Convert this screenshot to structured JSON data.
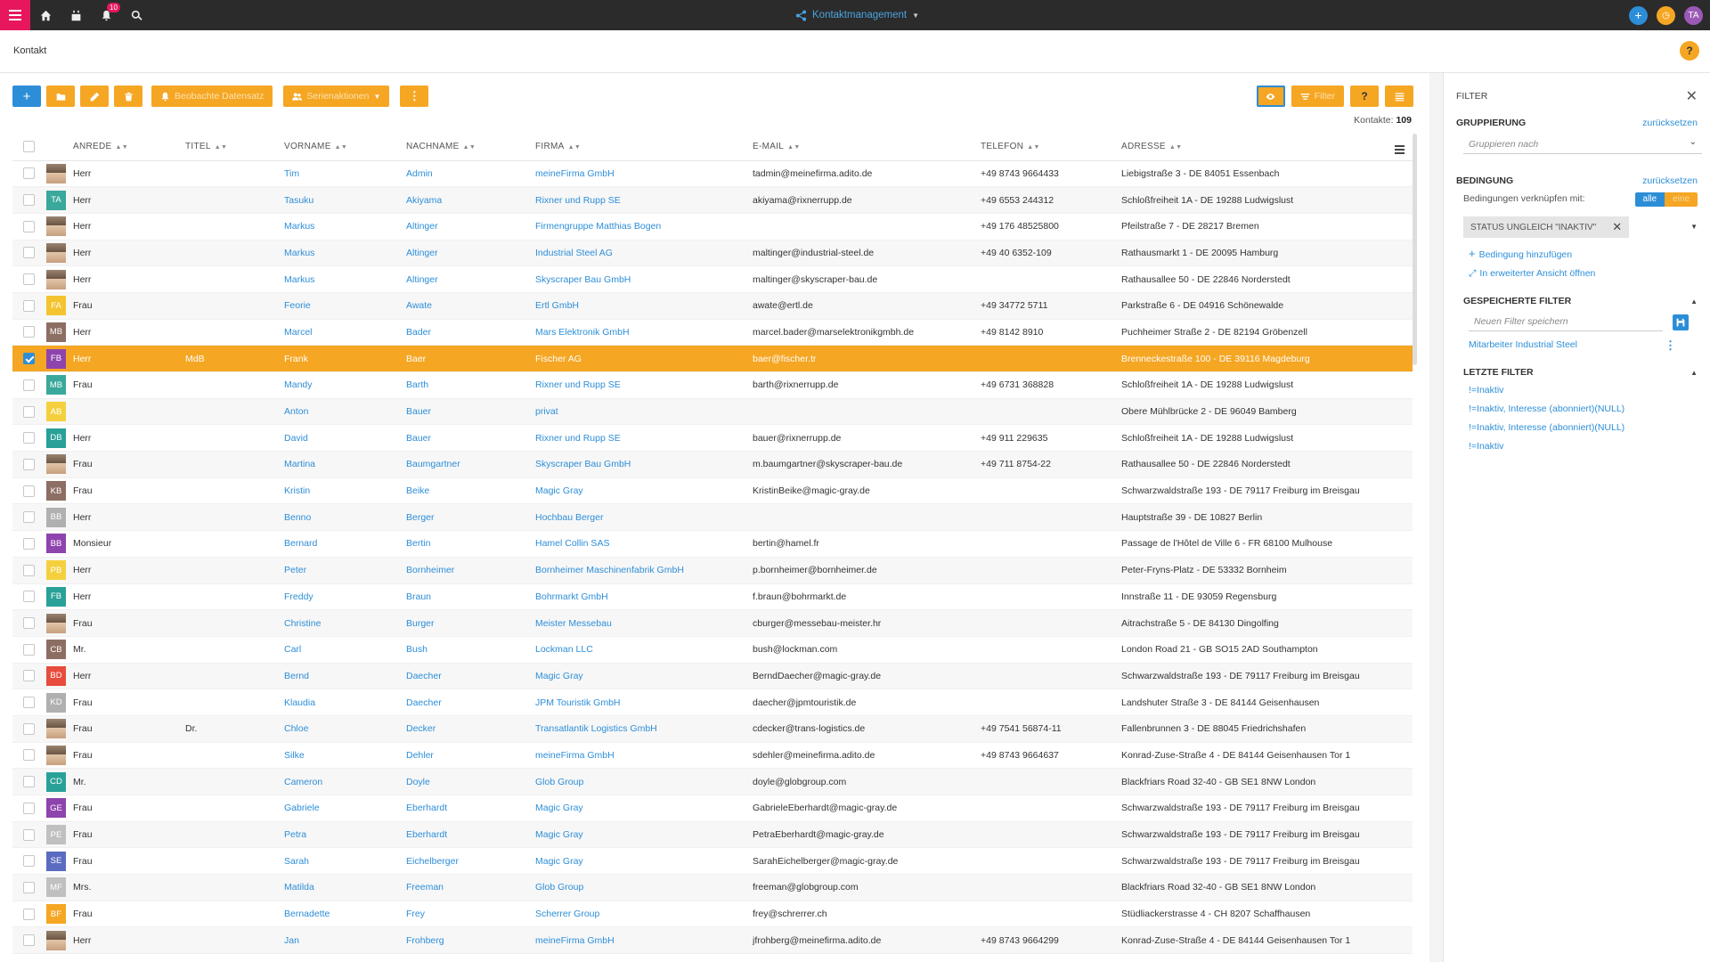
{
  "topbar": {
    "notifications": "10",
    "app_title": "Kontaktmanagement",
    "user_initials": "TA"
  },
  "breadcrumb": "Kontakt",
  "toolbar": {
    "observe_label": "Beobachte Datensatz",
    "series_label": "Serienaktionen",
    "filter_label": "Filter"
  },
  "count_label": "Kontakte:",
  "count_value": "109",
  "columns": [
    "Anrede",
    "Titel",
    "Vorname",
    "Nachname",
    "Firma",
    "E-Mail",
    "Telefon",
    "Adresse"
  ],
  "rows": [
    {
      "initials": "",
      "color": "",
      "photo": true,
      "anrede": "Herr",
      "titel": "",
      "vorname": "Tim",
      "nachname": "Admin",
      "firma": "meineFirma GmbH",
      "email": "tadmin@meinefirma.adito.de",
      "telefon": "+49 8743 9664433",
      "adresse": "Liebigstraße 3 - DE 84051 Essenbach"
    },
    {
      "initials": "TA",
      "color": "#3aa89b",
      "photo": false,
      "anrede": "Herr",
      "titel": "",
      "vorname": "Tasuku",
      "nachname": "Akiyama",
      "firma": "Rixner und Rupp SE",
      "email": "akiyama@rixnerrupp.de",
      "telefon": "+49 6553 244312",
      "adresse": "Schloßfreiheit 1A - DE 19288 Ludwigslust"
    },
    {
      "initials": "",
      "color": "",
      "photo": true,
      "anrede": "Herr",
      "titel": "",
      "vorname": "Markus",
      "nachname": "Altinger",
      "firma": "Firmengruppe Matthias Bogen",
      "email": "",
      "telefon": "+49 176 48525800",
      "adresse": "Pfeilstraße 7 - DE 28217 Bremen"
    },
    {
      "initials": "",
      "color": "",
      "photo": true,
      "anrede": "Herr",
      "titel": "",
      "vorname": "Markus",
      "nachname": "Altinger",
      "firma": "Industrial Steel AG",
      "email": "maltinger@industrial-steel.de",
      "telefon": "+49 40 6352-109",
      "adresse": "Rathausmarkt 1 - DE 20095 Hamburg"
    },
    {
      "initials": "",
      "color": "",
      "photo": true,
      "anrede": "Herr",
      "titel": "",
      "vorname": "Markus",
      "nachname": "Altinger",
      "firma": "Skyscraper Bau GmbH",
      "email": "maltinger@skyscraper-bau.de",
      "telefon": "",
      "adresse": "Rathausallee 50 - DE 22846 Norderstedt"
    },
    {
      "initials": "FA",
      "color": "#f4c430",
      "photo": false,
      "anrede": "Frau",
      "titel": "",
      "vorname": "Feorie",
      "nachname": "Awate",
      "firma": "Ertl GmbH",
      "email": "awate@ertl.de",
      "telefon": "+49 34772 5711",
      "adresse": "Parkstraße 6 - DE 04916 Schönewalde"
    },
    {
      "initials": "MB",
      "color": "#8d6e63",
      "photo": false,
      "anrede": "Herr",
      "titel": "",
      "vorname": "Marcel",
      "nachname": "Bader",
      "firma": "Mars Elektronik GmbH",
      "email": "marcel.bader@marselektronikgmbh.de",
      "telefon": "+49 8142 8910",
      "adresse": "Puchheimer Straße 2 - DE 82194 Gröbenzell"
    },
    {
      "initials": "FB",
      "color": "#8e44ad",
      "photo": false,
      "selected": true,
      "anrede": "Herr",
      "titel": "MdB",
      "vorname": "Frank",
      "nachname": "Baer",
      "firma": "Fischer AG",
      "email": "baer@fischer.tr",
      "telefon": "",
      "adresse": "Brenneckestraße 100 - DE 39116 Magdeburg"
    },
    {
      "initials": "MB",
      "color": "#3aa89b",
      "photo": false,
      "anrede": "Frau",
      "titel": "",
      "vorname": "Mandy",
      "nachname": "Barth",
      "firma": "Rixner und Rupp SE",
      "email": "barth@rixnerrupp.de",
      "telefon": "+49 6731 368828",
      "adresse": "Schloßfreiheit 1A - DE 19288 Ludwigslust"
    },
    {
      "initials": "AB",
      "color": "#f4d03f",
      "photo": false,
      "anrede": "",
      "titel": "",
      "vorname": "Anton",
      "nachname": "Bauer",
      "firma": "privat",
      "email": "",
      "telefon": "",
      "adresse": "Obere Mühlbrücke 2 - DE 96049 Bamberg"
    },
    {
      "initials": "DB",
      "color": "#2aa198",
      "photo": false,
      "anrede": "Herr",
      "titel": "",
      "vorname": "David",
      "nachname": "Bauer",
      "firma": "Rixner und Rupp SE",
      "email": "bauer@rixnerrupp.de",
      "telefon": "+49 911 229635",
      "adresse": "Schloßfreiheit 1A - DE 19288 Ludwigslust"
    },
    {
      "initials": "",
      "color": "",
      "photo": true,
      "anrede": "Frau",
      "titel": "",
      "vorname": "Martina",
      "nachname": "Baumgartner",
      "firma": "Skyscraper Bau GmbH",
      "email": "m.baumgartner@skyscraper-bau.de",
      "telefon": "+49 711 8754-22",
      "adresse": "Rathausallee 50 - DE 22846 Norderstedt"
    },
    {
      "initials": "KB",
      "color": "#8d6e63",
      "photo": false,
      "anrede": "Frau",
      "titel": "",
      "vorname": "Kristin",
      "nachname": "Beike",
      "firma": "Magic Gray",
      "email": "KristinBeike@magic-gray.de",
      "telefon": "",
      "adresse": "Schwarzwaldstraße 193 - DE 79117 Freiburg im Breisgau"
    },
    {
      "initials": "BB",
      "color": "#b0b0b0",
      "photo": false,
      "anrede": "Herr",
      "titel": "",
      "vorname": "Benno",
      "nachname": "Berger",
      "firma": "Hochbau Berger",
      "email": "",
      "telefon": "",
      "adresse": "Hauptstraße 39 - DE 10827 Berlin"
    },
    {
      "initials": "BB",
      "color": "#8e44ad",
      "photo": false,
      "anrede": "Monsieur",
      "titel": "",
      "vorname": "Bernard",
      "nachname": "Bertin",
      "firma": "Hamel Collin SAS",
      "email": "bertin@hamel.fr",
      "telefon": "",
      "adresse": "Passage de l'Hôtel de Ville 6 - FR 68100 Mulhouse"
    },
    {
      "initials": "PB",
      "color": "#f4d03f",
      "photo": false,
      "anrede": "Herr",
      "titel": "",
      "vorname": "Peter",
      "nachname": "Bornheimer",
      "firma": "Bornheimer Maschinenfabrik GmbH",
      "email": "p.bornheimer@bornheimer.de",
      "telefon": "",
      "adresse": "Peter-Fryns-Platz - DE 53332 Bornheim"
    },
    {
      "initials": "FB",
      "color": "#2aa198",
      "photo": false,
      "anrede": "Herr",
      "titel": "",
      "vorname": "Freddy",
      "nachname": "Braun",
      "firma": "Bohrmarkt GmbH",
      "email": "f.braun@bohrmarkt.de",
      "telefon": "",
      "adresse": "Innstraße 11 - DE 93059 Regensburg"
    },
    {
      "initials": "",
      "color": "",
      "photo": true,
      "anrede": "Frau",
      "titel": "",
      "vorname": "Christine",
      "nachname": "Burger",
      "firma": "Meister Messebau",
      "email": "cburger@messebau-meister.hr",
      "telefon": "",
      "adresse": "Aitrachstraße 5 - DE 84130 Dingolfing"
    },
    {
      "initials": "CB",
      "color": "#8d6e63",
      "photo": false,
      "anrede": "Mr.",
      "titel": "",
      "vorname": "Carl",
      "nachname": "Bush",
      "firma": "Lockman LLC",
      "email": "bush@lockman.com",
      "telefon": "",
      "adresse": "London Road 21 - GB SO15 2AD Southampton"
    },
    {
      "initials": "BD",
      "color": "#e74c3c",
      "photo": false,
      "anrede": "Herr",
      "titel": "",
      "vorname": "Bernd",
      "nachname": "Daecher",
      "firma": "Magic Gray",
      "email": "BerndDaecher@magic-gray.de",
      "telefon": "",
      "adresse": "Schwarzwaldstraße 193 - DE 79117 Freiburg im Breisgau"
    },
    {
      "initials": "KD",
      "color": "#b0b0b0",
      "photo": false,
      "anrede": "Frau",
      "titel": "",
      "vorname": "Klaudia",
      "nachname": "Daecher",
      "firma": "JPM Touristik GmbH",
      "email": "daecher@jpmtouristik.de",
      "telefon": "",
      "adresse": "Landshuter Straße 3 - DE 84144 Geisenhausen"
    },
    {
      "initials": "",
      "color": "",
      "photo": true,
      "anrede": "Frau",
      "titel": "Dr.",
      "vorname": "Chloe",
      "nachname": "Decker",
      "firma": "Transatlantik Logistics GmbH",
      "email": "cdecker@trans-logistics.de",
      "telefon": "+49 7541 56874-11",
      "adresse": "Fallenbrunnen 3 - DE 88045 Friedrichshafen"
    },
    {
      "initials": "",
      "color": "",
      "photo": true,
      "anrede": "Frau",
      "titel": "",
      "vorname": "Silke",
      "nachname": "Dehler",
      "firma": "meineFirma GmbH",
      "email": "sdehler@meinefirma.adito.de",
      "telefon": "+49 8743 9664637",
      "adresse": "Konrad-Zuse-Straße 4 - DE 84144 Geisenhausen Tor 1"
    },
    {
      "initials": "CD",
      "color": "#2aa198",
      "photo": false,
      "anrede": "Mr.",
      "titel": "",
      "vorname": "Cameron",
      "nachname": "Doyle",
      "firma": "Glob Group",
      "email": "doyle@globgroup.com",
      "telefon": "",
      "adresse": "Blackfriars Road 32-40 - GB SE1 8NW London"
    },
    {
      "initials": "GE",
      "color": "#8e44ad",
      "photo": false,
      "anrede": "Frau",
      "titel": "",
      "vorname": "Gabriele",
      "nachname": "Eberhardt",
      "firma": "Magic Gray",
      "email": "GabrieleEberhardt@magic-gray.de",
      "telefon": "",
      "adresse": "Schwarzwaldstraße 193 - DE 79117 Freiburg im Breisgau"
    },
    {
      "initials": "PE",
      "color": "#c0c0c0",
      "photo": false,
      "anrede": "Frau",
      "titel": "",
      "vorname": "Petra",
      "nachname": "Eberhardt",
      "firma": "Magic Gray",
      "email": "PetraEberhardt@magic-gray.de",
      "telefon": "",
      "adresse": "Schwarzwaldstraße 193 - DE 79117 Freiburg im Breisgau"
    },
    {
      "initials": "SE",
      "color": "#5b6bc0",
      "photo": false,
      "anrede": "Frau",
      "titel": "",
      "vorname": "Sarah",
      "nachname": "Eichelberger",
      "firma": "Magic Gray",
      "email": "SarahEichelberger@magic-gray.de",
      "telefon": "",
      "adresse": "Schwarzwaldstraße 193 - DE 79117 Freiburg im Breisgau"
    },
    {
      "initials": "MF",
      "color": "#c0c0c0",
      "photo": false,
      "anrede": "Mrs.",
      "titel": "",
      "vorname": "Matilda",
      "nachname": "Freeman",
      "firma": "Glob Group",
      "email": "freeman@globgroup.com",
      "telefon": "",
      "adresse": "Blackfriars Road 32-40 - GB SE1 8NW London"
    },
    {
      "initials": "BF",
      "color": "#f5a623",
      "photo": false,
      "anrede": "Frau",
      "titel": "",
      "vorname": "Bernadette",
      "nachname": "Frey",
      "firma": "Scherrer Group",
      "email": "frey@schrerrer.ch",
      "telefon": "",
      "adresse": "Stüdliackerstrasse 4 - CH 8207 Schaffhausen"
    },
    {
      "initials": "",
      "color": "",
      "photo": true,
      "anrede": "Herr",
      "titel": "",
      "vorname": "Jan",
      "nachname": "Frohberg",
      "firma": "meineFirma GmbH",
      "email": "jfrohberg@meinefirma.adito.de",
      "telefon": "+49 8743 9664299",
      "adresse": "Konrad-Zuse-Straße 4 - DE 84144 Geisenhausen Tor 1"
    }
  ],
  "filter": {
    "title": "FILTER",
    "grouping_title": "Gruppierung",
    "reset_label": "zurücksetzen",
    "group_placeholder": "Gruppieren nach",
    "condition_title": "Bedingung",
    "link_label": "Bedingungen verknüpfen mit:",
    "toggle_all": "alle",
    "toggle_one": "eine",
    "chip_label": "STATUS UNGLEICH \"INAKTIV\"",
    "add_condition": "Bedingung hinzufügen",
    "open_advanced": "In erweiterter Ansicht öffnen",
    "saved_title": "Gespeicherte Filter",
    "save_placeholder": "Neuen Filter speichern",
    "saved_item": "Mitarbeiter Industrial Steel",
    "recent_title": "Letzte Filter",
    "recent": [
      "!=Inaktiv",
      "!=Inaktiv, Interesse (abonniert)(NULL)",
      "!=Inaktiv, Interesse (abonniert)(NULL)",
      "!=Inaktiv"
    ]
  }
}
